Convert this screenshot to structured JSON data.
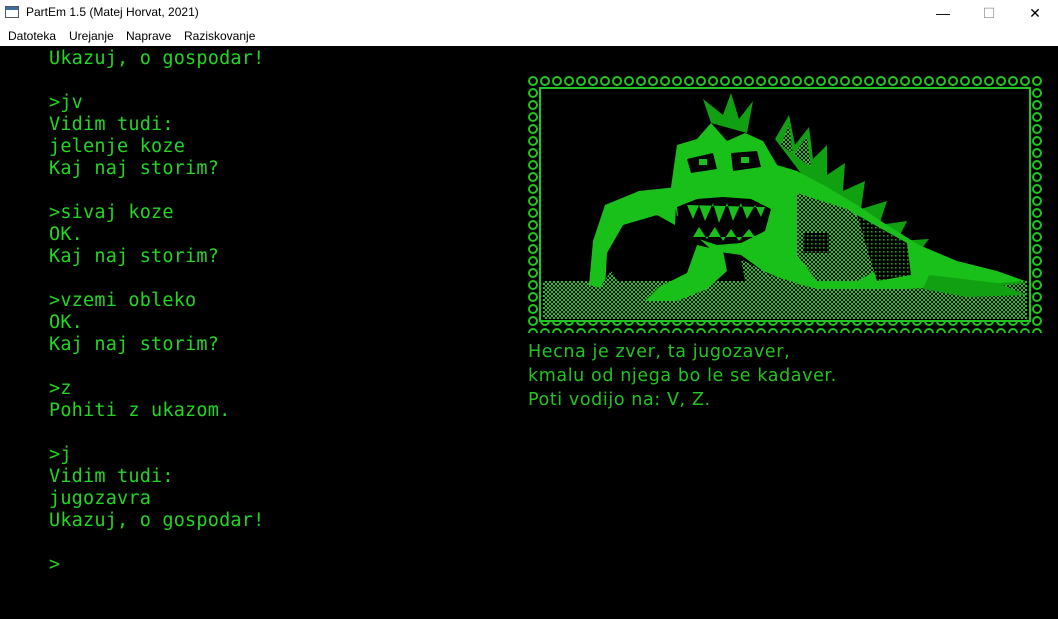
{
  "window": {
    "title": "PartEm 1.5 (Matej Horvat, 2021)",
    "minimize_glyph": "—",
    "maximize_glyph": "☐",
    "close_glyph": "✕"
  },
  "menu": [
    "Datoteka",
    "Urejanje",
    "Naprave",
    "Raziskovanje"
  ],
  "terminal_lines": [
    "Ukazuj, o gospodar!",
    "",
    ">jv",
    "Vidim tudi:",
    "jelenje koze",
    "Kaj naj storim?",
    "",
    ">sivaj koze",
    "OK.",
    "Kaj naj storim?",
    "",
    ">vzemi obleko",
    "OK.",
    "Kaj naj storim?",
    "",
    ">z",
    "Pohiti z ukazom.",
    "",
    ">j",
    "Vidim tudi:",
    "jugozavra",
    "Ukazuj, o gospodar!",
    "",
    ">"
  ],
  "room_description": [
    "Hecna je zver, ta jugozaver,",
    "kmalu od njega bo le se kadaver.",
    "Poti vodijo na: V, Z."
  ],
  "colors": {
    "terminal_green": "#22d622",
    "dark_green": "#0b7a0b",
    "background": "#000000"
  },
  "icons": {
    "app": "app-window-icon",
    "picture": "dinosaur-illustration"
  }
}
